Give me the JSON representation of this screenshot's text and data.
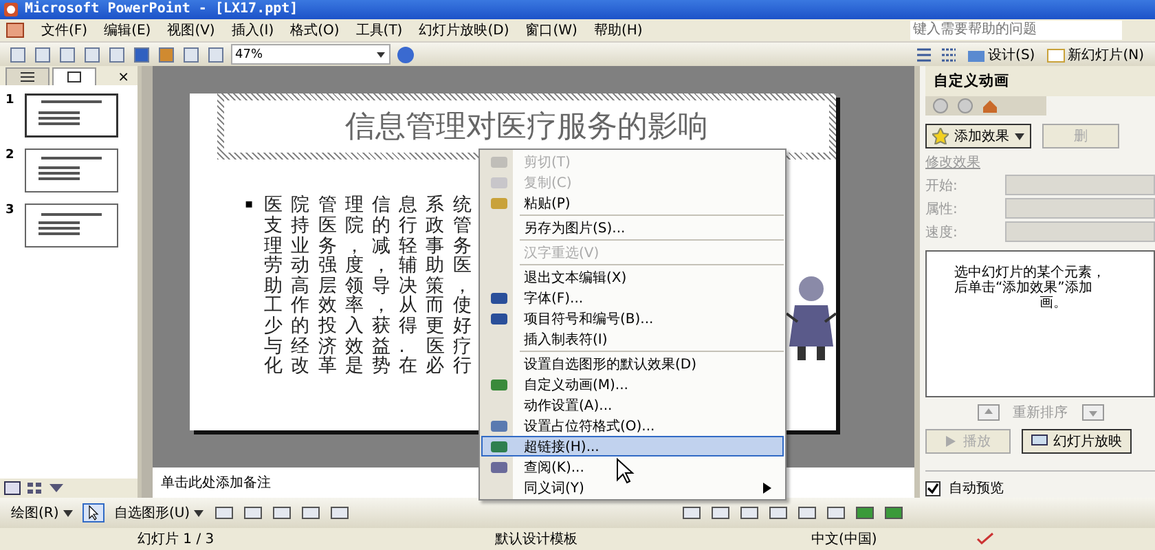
{
  "window": {
    "title": "Microsoft PowerPoint - [LX17.ppt]"
  },
  "menu_bar": {
    "items": [
      "文件(F)",
      "编辑(E)",
      "视图(V)",
      "插入(I)",
      "格式(O)",
      "工具(T)",
      "幻灯片放映(D)",
      "窗口(W)",
      "帮助(H)"
    ],
    "help_placeholder": "键入需要帮助的问题"
  },
  "toolbar": {
    "zoom": "47%",
    "design": "设计(S)",
    "new_slide": "新幻灯片(N)"
  },
  "slide_pane": {
    "tabs": [
      {
        "kind": "outline",
        "selected": false
      },
      {
        "kind": "slides",
        "selected": true
      }
    ],
    "close": "×",
    "thumbnails": [
      {
        "number": "1",
        "selected": true
      },
      {
        "number": "2",
        "selected": false
      },
      {
        "number": "3",
        "selected": false
      }
    ]
  },
  "slide": {
    "title": "信息管理对医疗服务的影响",
    "bullet": "▪",
    "body_lines": [
      "医院管理信息系统",
      "支持医院的行政管",
      "理业务，减轻事务",
      "劳动强度，辅助医",
      "助高层领导决策，",
      "工作效率，从而使",
      "少的投入获得更好",
      "与经济效益. 医疗",
      "化改革是势在必行"
    ]
  },
  "notes": {
    "placeholder": "单击此处添加备注"
  },
  "task_pane": {
    "title": "自定义动画",
    "add_effect": "添加效果",
    "remove": {
      "label": "删",
      "disabled": true
    },
    "section": "修改效果",
    "fields": [
      {
        "label": "开始:"
      },
      {
        "label": "属性:"
      },
      {
        "label": "速度:"
      }
    ],
    "hint_lines": [
      "选中幻灯片的某个元素，",
      "后单击“添加效果”添加",
      "画。"
    ],
    "reorder": "重新排序",
    "play": {
      "label": "播放",
      "disabled": true
    },
    "slideshow": "幻灯片放映",
    "autopreview": {
      "label": "自动预览",
      "checked": true
    }
  },
  "context_menu": [
    {
      "kind": "item",
      "label": "剪切(T)",
      "disabled": true,
      "selected": false
    },
    {
      "kind": "item",
      "label": "复制(C)",
      "disabled": true,
      "selected": false
    },
    {
      "kind": "item",
      "label": "粘贴(P)",
      "disabled": false,
      "selected": false
    },
    {
      "kind": "separator"
    },
    {
      "kind": "item",
      "label": "另存为图片(S)...",
      "disabled": false,
      "selected": false
    },
    {
      "kind": "separator"
    },
    {
      "kind": "item",
      "label": "汉字重选(V)",
      "disabled": true,
      "selected": false
    },
    {
      "kind": "separator"
    },
    {
      "kind": "item",
      "label": "退出文本编辑(X)",
      "disabled": false,
      "selected": false
    },
    {
      "kind": "item",
      "label": "字体(F)...",
      "disabled": false,
      "selected": false
    },
    {
      "kind": "item",
      "label": "项目符号和编号(B)...",
      "disabled": false,
      "selected": false
    },
    {
      "kind": "item",
      "label": "插入制表符(I)",
      "disabled": false,
      "selected": false
    },
    {
      "kind": "separator"
    },
    {
      "kind": "item",
      "label": "设置自选图形的默认效果(D)",
      "disabled": false,
      "selected": false
    },
    {
      "kind": "item",
      "label": "自定义动画(M)...",
      "disabled": false,
      "selected": false
    },
    {
      "kind": "item",
      "label": "动作设置(A)...",
      "disabled": false,
      "selected": false
    },
    {
      "kind": "item",
      "label": "设置占位符格式(O)...",
      "disabled": false,
      "selected": false
    },
    {
      "kind": "item",
      "label": "超链接(H)...",
      "disabled": false,
      "selected": true
    },
    {
      "kind": "item",
      "label": "查阅(K)...",
      "disabled": false,
      "selected": false
    },
    {
      "kind": "submenu",
      "label": "同义词(Y)",
      "disabled": false,
      "selected": false
    }
  ],
  "drawing_toolbar": {
    "draw": "绘图(R)",
    "autoshapes": "自选图形(U)"
  },
  "status_bar": [
    "幻灯片 1 / 3",
    "默认设计模板",
    "中文(中国)"
  ]
}
